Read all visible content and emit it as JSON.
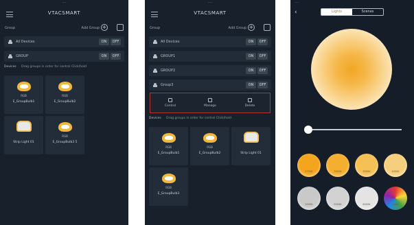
{
  "app_title": "VTACSMART",
  "header": {
    "group_label": "Group",
    "add_group_label": "Add Group"
  },
  "groups_p1": [
    {
      "name": "All Devices",
      "on": "ON",
      "off": "OFF"
    },
    {
      "name": "GROUP",
      "on": "ON",
      "off": "OFF"
    }
  ],
  "groups_p2": [
    {
      "name": "All Devices",
      "on": "ON",
      "off": "OFF"
    },
    {
      "name": "GROUP1",
      "on": "ON",
      "off": "OFF"
    },
    {
      "name": "GROUP2",
      "on": "ON",
      "off": "OFF"
    },
    {
      "name": "Group3",
      "on": "ON",
      "off": "OFF"
    }
  ],
  "context_menu": [
    "Control",
    "Manage",
    "Delete"
  ],
  "devices_header": {
    "label": "Devices",
    "hint": "Drag groups in order for control Click/hold"
  },
  "tiles_p1": [
    {
      "sub": "RGB",
      "name": "E_GroupBulb1",
      "type": "bulb"
    },
    {
      "sub": "RGB",
      "name": "E_GroupBulb2",
      "type": "bulb"
    },
    {
      "sub": "",
      "name": "Strip Light 01",
      "type": "strip"
    },
    {
      "sub": "RGB",
      "name": "E_GroupBulb3 5",
      "type": "bulb"
    }
  ],
  "tiles_p2": [
    {
      "sub": "RGB",
      "name": "E_GroupBulb1",
      "type": "bulb"
    },
    {
      "sub": "RGB",
      "name": "E_GroupBulb2",
      "type": "bulb"
    },
    {
      "sub": "",
      "name": "Strip Light 01",
      "type": "strip"
    },
    {
      "sub": "RGB",
      "name": "E_GroupBulb3",
      "type": "bulb"
    }
  ],
  "color_screen": {
    "tabs": [
      "Lights",
      "Scenes"
    ],
    "back": "‹",
    "brightness_fraction": 0.03,
    "swatches": [
      {
        "color": "#f3a51e",
        "label": "2700K"
      },
      {
        "color": "#f4ae30",
        "label": "3000K"
      },
      {
        "color": "#f5c056",
        "label": "3500K"
      },
      {
        "color": "#f6cf7c",
        "label": "4000K"
      },
      {
        "color": "#c9c9c9",
        "label": "5000K"
      },
      {
        "color": "#d2d2d2",
        "label": "5500K"
      },
      {
        "color": "#e4e4e4",
        "label": "6500K"
      },
      {
        "color": "rainbow",
        "label": "Color"
      }
    ]
  }
}
